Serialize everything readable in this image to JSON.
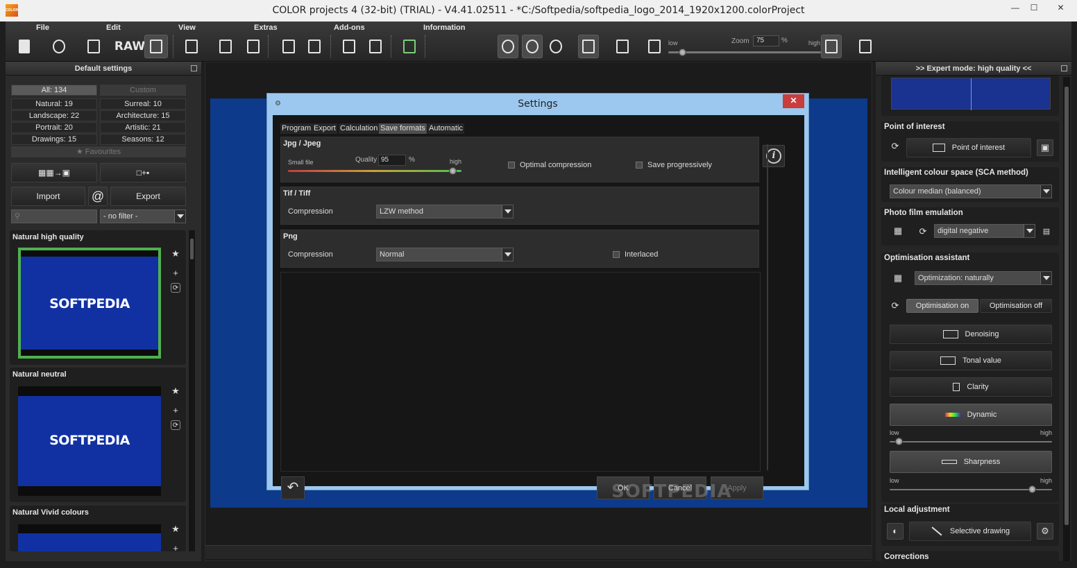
{
  "window": {
    "title": "COLOR projects 4 (32-bit) (TRIAL) - V4.41.02511 - *C:/Softpedia/softpedia_logo_2014_1920x1200.colorProject",
    "app_icon_text": "COLOR",
    "min_glyph": "—",
    "max_glyph": "☐",
    "close_glyph": "✕"
  },
  "menu": {
    "file": "File",
    "edit": "Edit",
    "view": "View",
    "extras": "Extras",
    "addons": "Add-ons",
    "information": "Information"
  },
  "toolbar": {
    "raw_label": "RAW",
    "zoom_label": "Zoom",
    "zoom_value": "75",
    "zoom_unit": "%",
    "zoom_low": "low",
    "zoom_high": "high"
  },
  "left_panel": {
    "title": "Default settings",
    "categories": [
      {
        "label": "All: 134"
      },
      {
        "label": "Custom"
      },
      {
        "label": "Natural: 19"
      },
      {
        "label": "Surreal: 10"
      },
      {
        "label": "Landscape: 22"
      },
      {
        "label": "Architecture: 15"
      },
      {
        "label": "Portrait: 20"
      },
      {
        "label": "Artistic: 21"
      },
      {
        "label": "Drawings: 15"
      },
      {
        "label": "Seasons: 12"
      }
    ],
    "favourites": "Favourites",
    "import_label": "Import",
    "at_label": "@",
    "export_label": "Export",
    "filter_value": "- no filter -",
    "presets": [
      {
        "title": "Natural high quality",
        "brand": "SOFTPEDIA"
      },
      {
        "title": "Natural neutral",
        "brand": "SOFTPEDIA"
      },
      {
        "title": "Natural Vivid colours",
        "brand": ""
      }
    ]
  },
  "dialog": {
    "title": "Settings",
    "tabs": [
      "Program",
      "Export",
      "Calculation",
      "Save formats",
      "Automatic"
    ],
    "jpeg": {
      "title": "Jpg / Jpeg",
      "small_file": "Small file",
      "quality_label": "Quality",
      "quality_value": "95",
      "quality_unit": "%",
      "high_label": "high",
      "quality_fraction": 0.95,
      "optimal_compression": "Optimal compression",
      "save_progressively": "Save progressively"
    },
    "tiff": {
      "title": "Tif / Tiff",
      "compression_label": "Compression",
      "compression_value": "LZW method"
    },
    "png": {
      "title": "Png",
      "compression_label": "Compression",
      "compression_value": "Normal",
      "interlaced": "Interlaced"
    },
    "ok": "OK",
    "cancel": "Cancel",
    "apply": "Apply",
    "info_glyph": "i",
    "undo_glyph": "↶",
    "watermark": "SOFTPEDIA"
  },
  "right_panel": {
    "title": ">> Expert mode: high quality <<",
    "point_of_interest": {
      "title": "Point of interest",
      "button": "Point of interest"
    },
    "sca": {
      "title": "Intelligent colour space (SCA method)",
      "value": "Colour median (balanced)"
    },
    "film": {
      "title": "Photo film emulation",
      "value": "digital negative"
    },
    "optim": {
      "title": "Optimisation assistant",
      "value": "Optimization: naturally",
      "on": "Optimisation on",
      "off": "Optimisation off",
      "denoising": "Denoising",
      "tonal": "Tonal value",
      "clarity": "Clarity",
      "dynamic": "Dynamic",
      "sharpness": "Sharpness",
      "low": "low",
      "high": "high"
    },
    "local": {
      "title": "Local adjustment",
      "button": "Selective drawing"
    },
    "corrections": {
      "title": "Corrections"
    }
  }
}
